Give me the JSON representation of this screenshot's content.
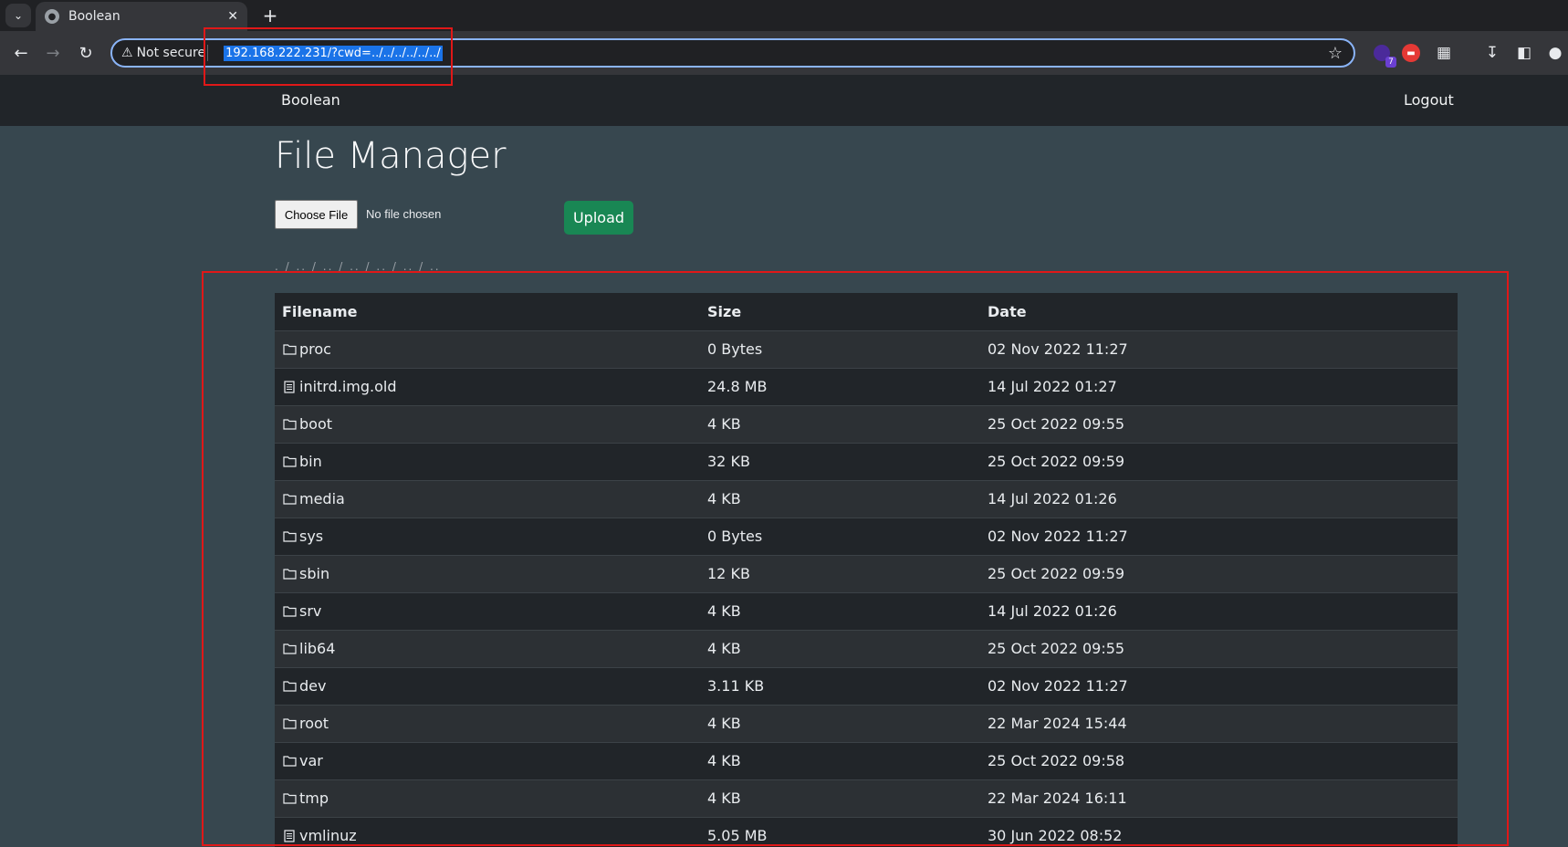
{
  "browser": {
    "tab": {
      "title": "Boolean"
    },
    "address": {
      "security_label": "Not secure",
      "url": "192.168.222.231/?cwd=../../../../../../"
    },
    "extension_badge": "7"
  },
  "site": {
    "brand": "Boolean",
    "logout_label": "Logout"
  },
  "page": {
    "title": "File Manager",
    "choose_file_label": "Choose File",
    "no_file_label": "No file chosen",
    "upload_label": "Upload",
    "breadcrumb": ". / .. / .. / .. / .. / .. / .."
  },
  "table": {
    "headers": {
      "filename": "Filename",
      "size": "Size",
      "date": "Date"
    },
    "rows": [
      {
        "type": "folder",
        "name": "proc",
        "size": "0 Bytes",
        "date": "02 Nov 2022 11:27"
      },
      {
        "type": "file",
        "name": "initrd.img.old",
        "size": "24.8 MB",
        "date": "14 Jul 2022 01:27"
      },
      {
        "type": "folder",
        "name": "boot",
        "size": "4 KB",
        "date": "25 Oct 2022 09:55"
      },
      {
        "type": "folder",
        "name": "bin",
        "size": "32 KB",
        "date": "25 Oct 2022 09:59"
      },
      {
        "type": "folder",
        "name": "media",
        "size": "4 KB",
        "date": "14 Jul 2022 01:26"
      },
      {
        "type": "folder",
        "name": "sys",
        "size": "0 Bytes",
        "date": "02 Nov 2022 11:27"
      },
      {
        "type": "folder",
        "name": "sbin",
        "size": "12 KB",
        "date": "25 Oct 2022 09:59"
      },
      {
        "type": "folder",
        "name": "srv",
        "size": "4 KB",
        "date": "14 Jul 2022 01:26"
      },
      {
        "type": "folder",
        "name": "lib64",
        "size": "4 KB",
        "date": "25 Oct 2022 09:55"
      },
      {
        "type": "folder",
        "name": "dev",
        "size": "3.11 KB",
        "date": "02 Nov 2022 11:27"
      },
      {
        "type": "folder",
        "name": "root",
        "size": "4 KB",
        "date": "22 Mar 2024 15:44"
      },
      {
        "type": "folder",
        "name": "var",
        "size": "4 KB",
        "date": "25 Oct 2022 09:58"
      },
      {
        "type": "folder",
        "name": "tmp",
        "size": "4 KB",
        "date": "22 Mar 2024 16:11"
      },
      {
        "type": "file",
        "name": "vmlinuz",
        "size": "5.05 MB",
        "date": "30 Jun 2022 08:52"
      }
    ]
  },
  "icons": {
    "folder": "folder-icon",
    "file": "file-icon"
  },
  "colors": {
    "page_bg": "#37474f",
    "navbar_bg": "#212529",
    "upload_button": "#198754",
    "highlight_box": "#e01818",
    "url_selection": "#1a73e8"
  }
}
